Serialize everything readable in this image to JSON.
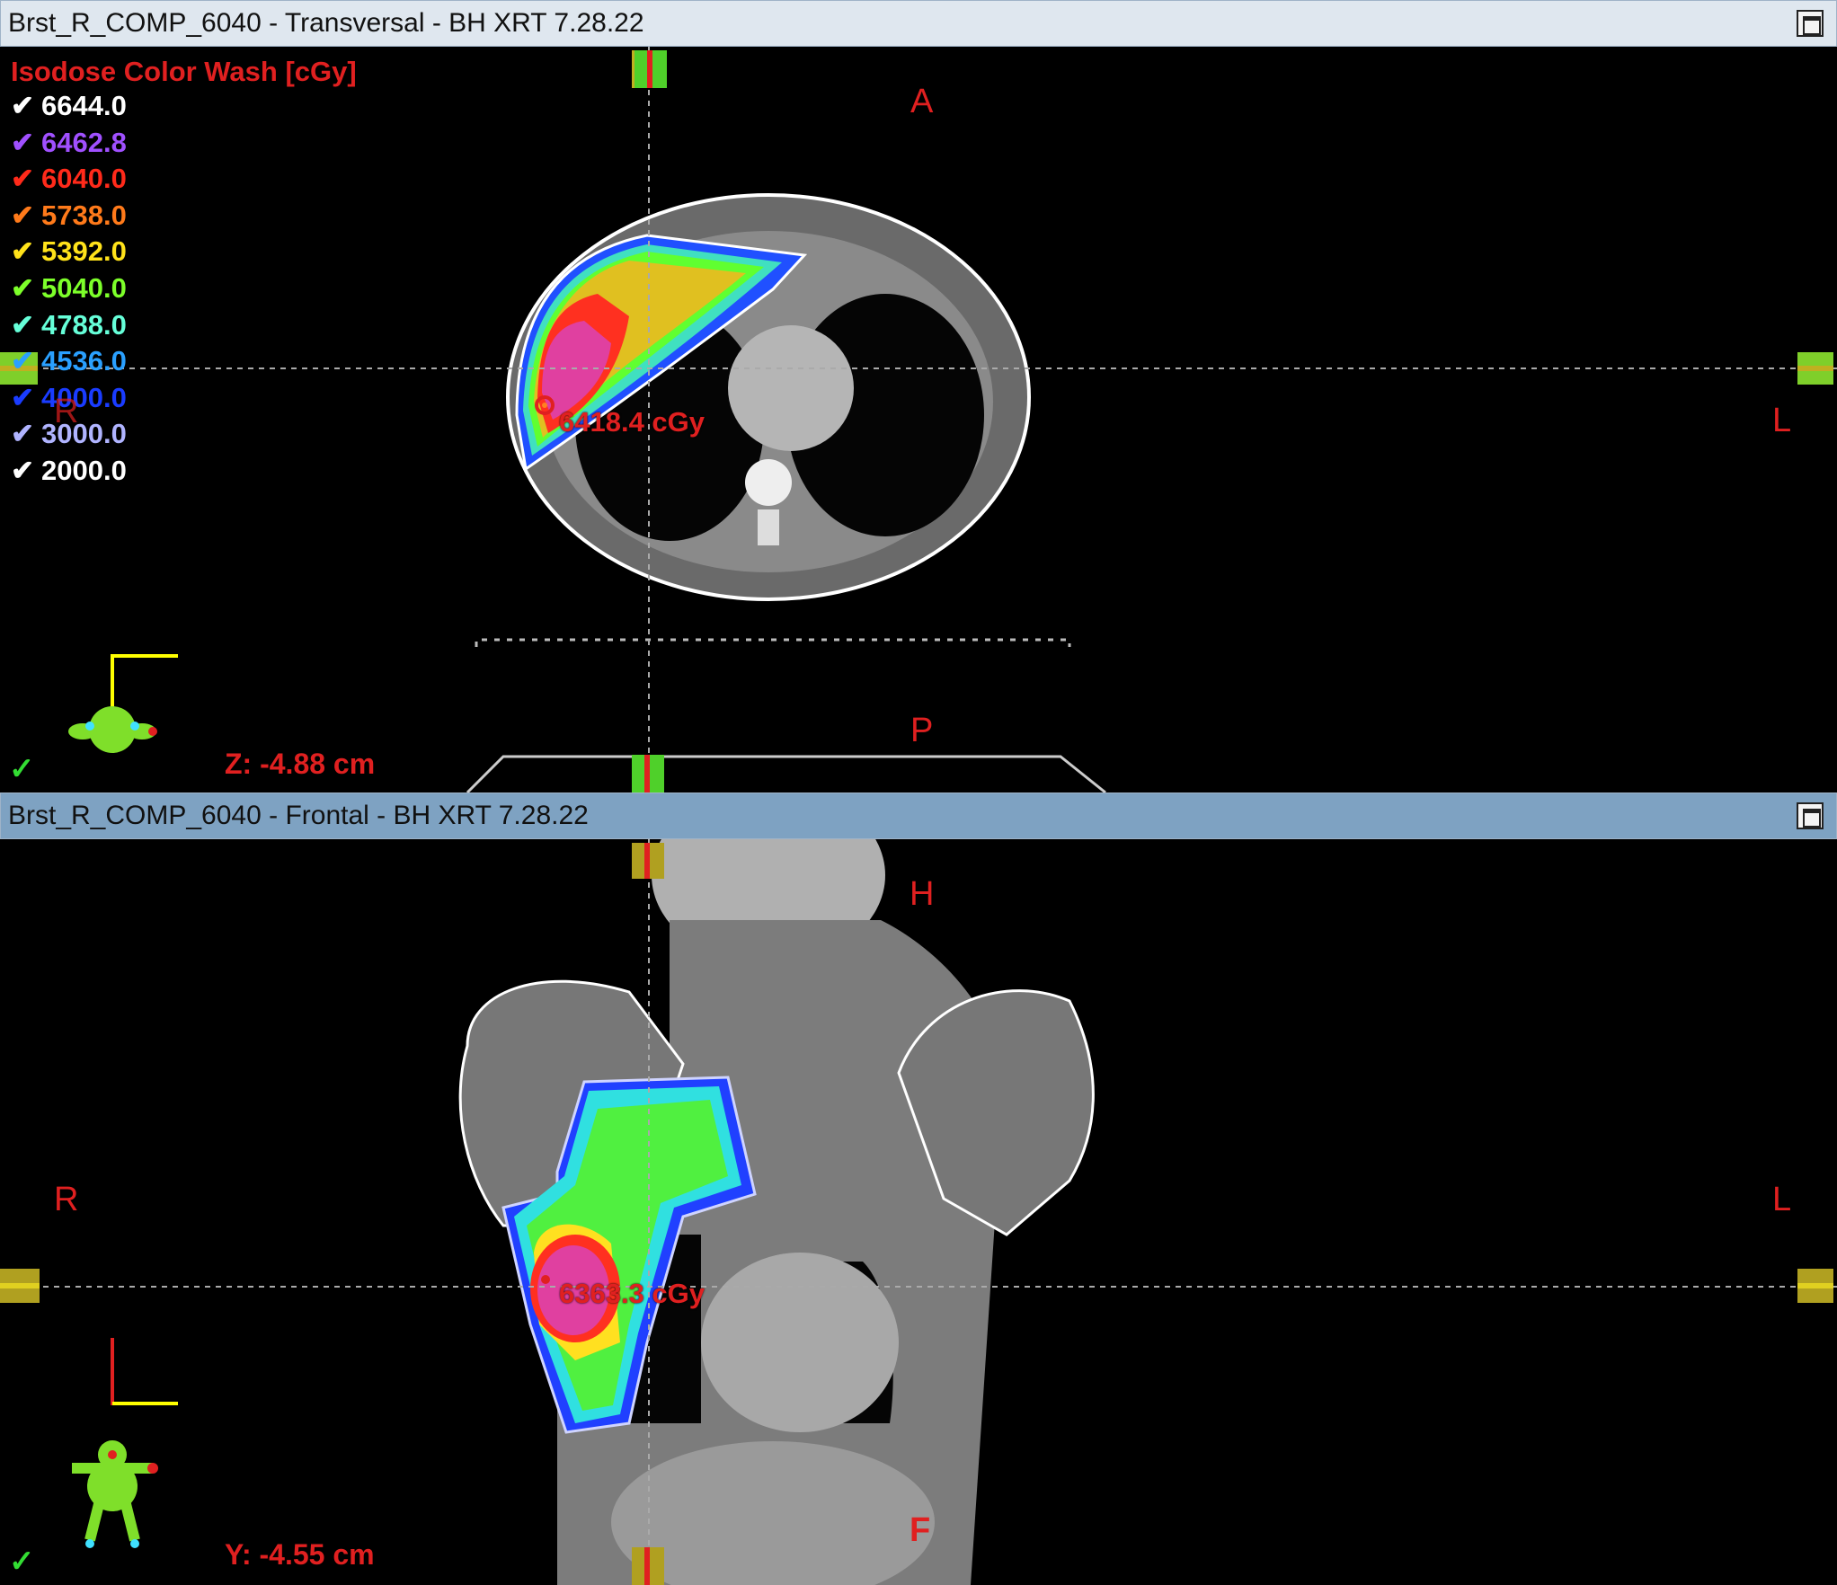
{
  "transversal": {
    "title": "Brst_R_COMP_6040 - Transversal - BH XRT 7.28.22",
    "legend_title": "Isodose Color Wash [cGy]",
    "legend": [
      {
        "value": "6644.0",
        "color": "#ffffff"
      },
      {
        "value": "6462.8",
        "color": "#a050ff"
      },
      {
        "value": "6040.0",
        "color": "#ff2a1a"
      },
      {
        "value": "5738.0",
        "color": "#ff7a1a"
      },
      {
        "value": "5392.0",
        "color": "#ffe21a"
      },
      {
        "value": "5040.0",
        "color": "#7dff2a"
      },
      {
        "value": "4788.0",
        "color": "#66ffd9"
      },
      {
        "value": "4536.0",
        "color": "#2aa0ff"
      },
      {
        "value": "4000.0",
        "color": "#1a3cff"
      },
      {
        "value": "3000.0",
        "color": "#b0b4ff"
      },
      {
        "value": "2000.0",
        "color": "#ffffff"
      }
    ],
    "orient_top": "A",
    "orient_bottom": "P",
    "orient_right": "L",
    "orient_left": "R",
    "dose_point": "6418.4 cGy",
    "position_readout": "Z: -4.88 cm",
    "check": "✓"
  },
  "frontal": {
    "title": "Brst_R_COMP_6040 - Frontal - BH XRT 7.28.22",
    "orient_top": "H",
    "orient_bottom": "F",
    "orient_left": "R",
    "orient_right": "L",
    "dose_point": "6363.3 cGy",
    "position_readout": "Y: -4.55 cm",
    "check": "✓"
  }
}
